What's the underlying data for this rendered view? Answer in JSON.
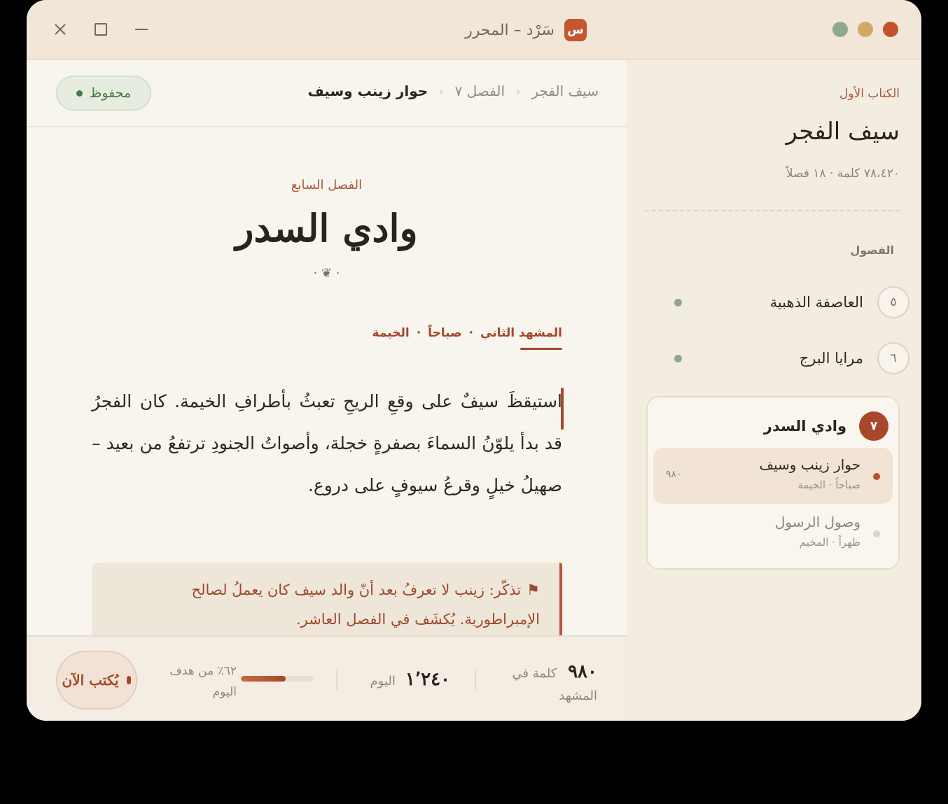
{
  "window": {
    "app_title": "سَرْد – المحرر",
    "app_logo_letter": "س"
  },
  "sidebar": {
    "book_label": "الكتاب الأول",
    "book_title": "سيف الفجر",
    "book_meta": "٧٨،٤٢٠ كلمة · ١٨ فصلاً",
    "section_label": "الفصول",
    "chapters": [
      {
        "num": "٥",
        "title": "العاصفة الذهبية"
      },
      {
        "num": "٦",
        "title": "مرايا البرج"
      }
    ],
    "active_chapter": {
      "num": "٧",
      "title": "وادي السدر",
      "scenes": [
        {
          "title": "حوار زينب وسيف",
          "sub": "صباحاً · الخيمة",
          "count": "٩٨٠"
        },
        {
          "title": "وصول الرسول",
          "sub": "ظهراً · المخيم",
          "count": ""
        }
      ]
    }
  },
  "header": {
    "saved_label": "محفوظ",
    "breadcrumb": [
      "سيف الفجر",
      "الفصل ٧",
      "حوار زينب وسيف"
    ]
  },
  "editor": {
    "chapter_label": "الفصل السابع",
    "chapter_title": "وادي السدر",
    "ornament": "· ❦ ·",
    "scene_tab": "المشهد الثاني",
    "scene_sep": "·",
    "scene_time": "صباحاً",
    "scene_place": "الخيمة",
    "prose": "استيقظَ سيفٌ على وقعِ الريحِ تعبثُ بأطرافِ الخيمة. كان الفجرُ قد بدأ يلوّنُ السماءَ بصفرةٍ خجلة، وأصواتُ الجنودِ ترتفعُ من بعيد – صهيلُ خيلٍ وقرعُ سيوفٍ على دروع.",
    "note": "تذكّر: زينب لا تعرفُ بعد أنّ والد سيف كان يعملُ لصالح الإمبراطورية. يُكشَف في الفصل العاشر."
  },
  "footer": {
    "scene_words_num": "٩٨٠",
    "scene_words_label": "كلمة في المشهد",
    "today_num": "١٬٢٤٠",
    "today_label": "اليوم",
    "goal_text": "٦٢٪ من هدف اليوم",
    "goal_progress": 0.62,
    "now_label": "يُكتب الآن"
  },
  "colors": {
    "accent": "#a2482b",
    "saved_green": "#4a7a47",
    "traffic_red": "#c4512b",
    "traffic_yellow": "#d3a766",
    "traffic_green": "#8fa98a"
  }
}
